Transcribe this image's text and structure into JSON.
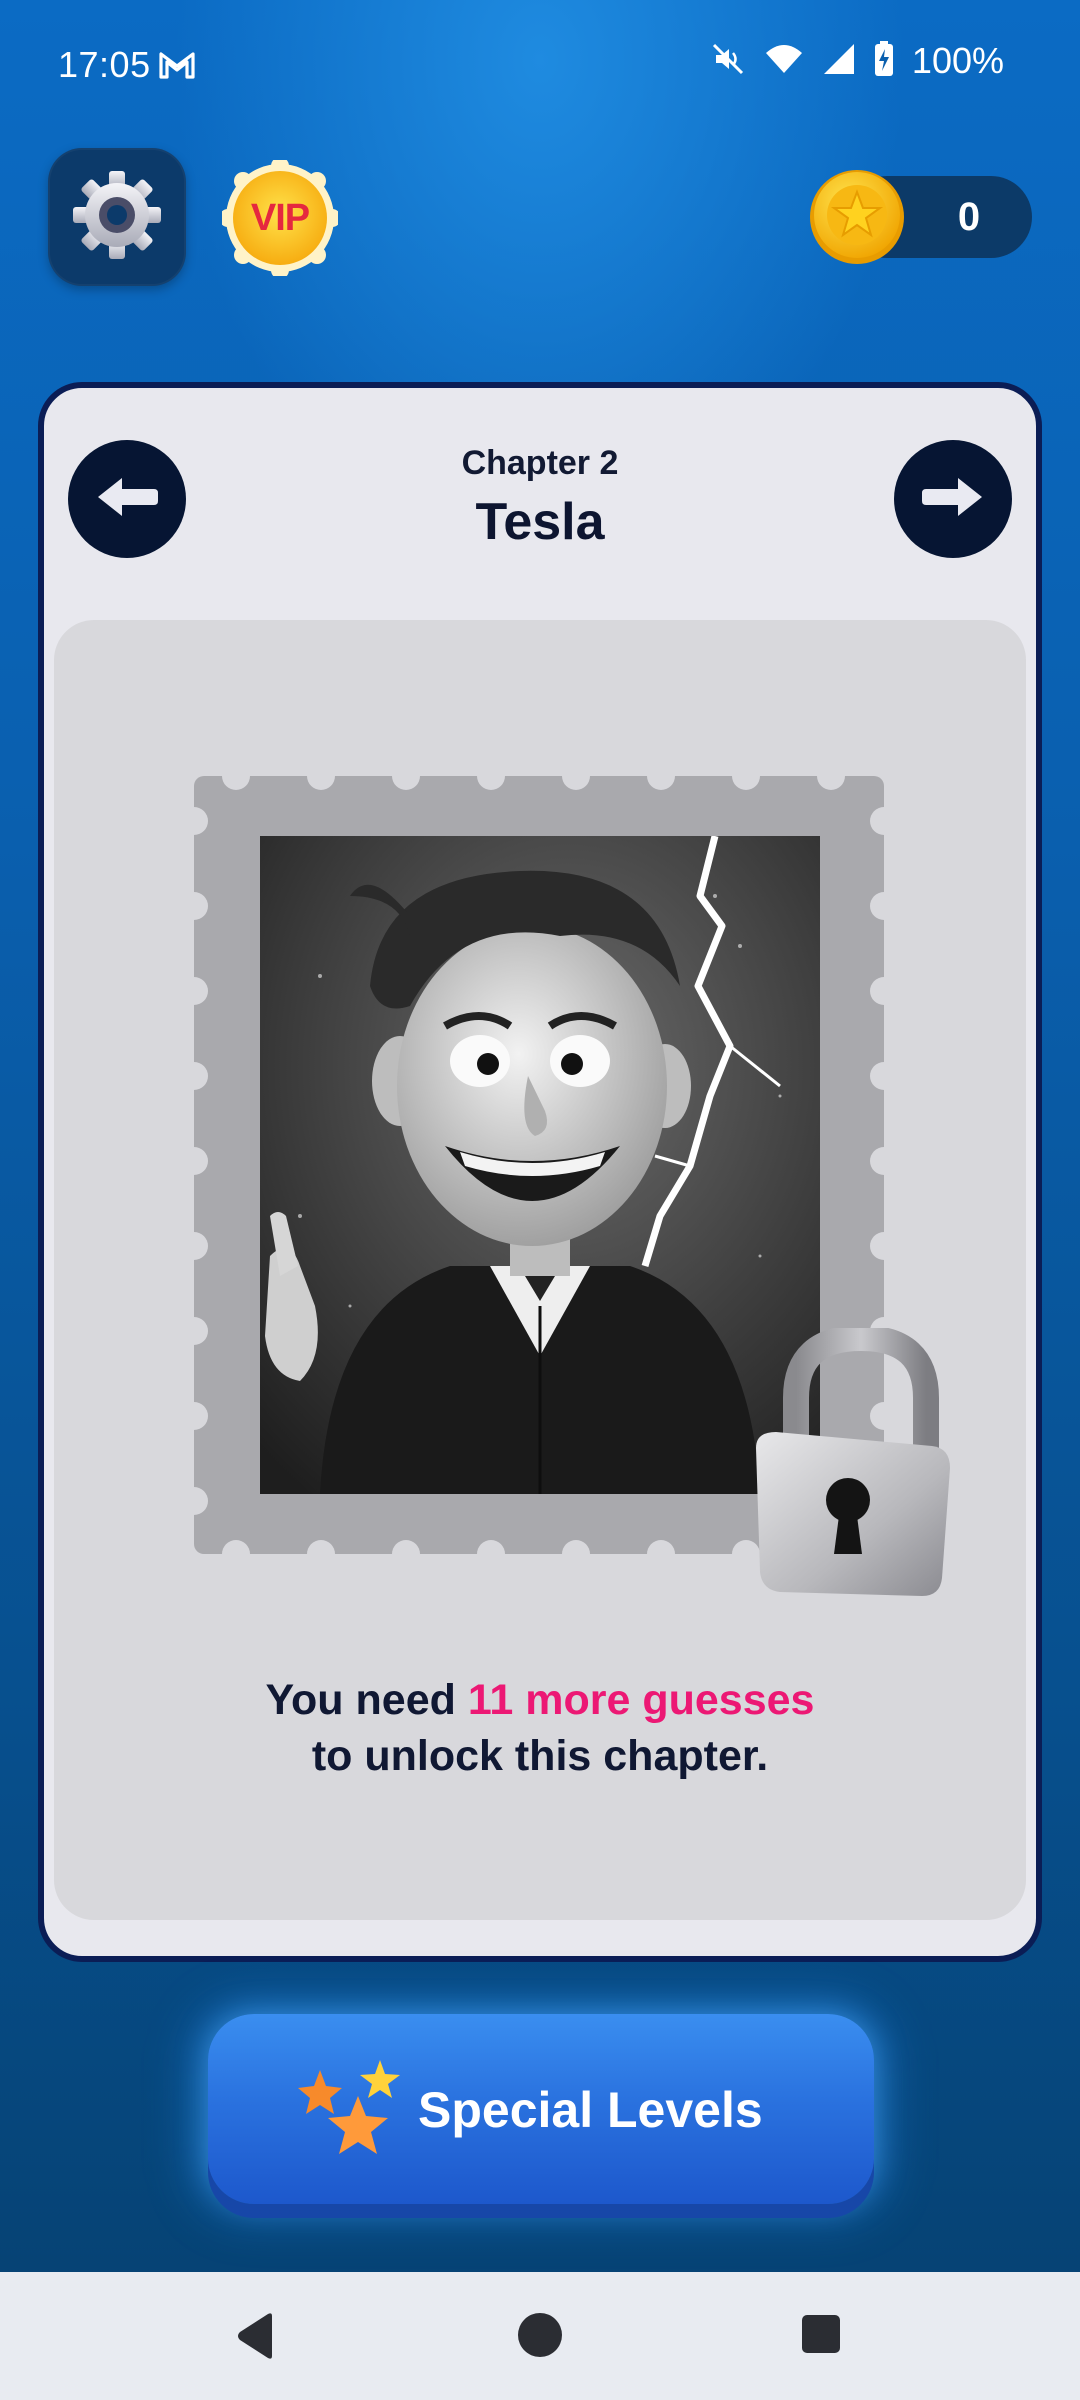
{
  "status_bar": {
    "time": "17:05",
    "battery": "100%",
    "icons": [
      "gmail-icon",
      "mute-icon",
      "wifi-icon",
      "signal-icon",
      "battery-charging-icon"
    ]
  },
  "top_bar": {
    "settings_icon": "gear-icon",
    "vip_label": "VIP",
    "coin_count": "0",
    "coin_icon": "star-coin-icon"
  },
  "chapter": {
    "number_label": "Chapter 2",
    "title": "Tesla",
    "prev_icon": "arrow-left-icon",
    "next_icon": "arrow-right-icon",
    "image_subject": "Tesla caricature stamp",
    "locked": true,
    "message": {
      "prefix": "You need ",
      "highlight": "11 more guesses",
      "suffix": "to unlock this chapter."
    }
  },
  "special_button": {
    "label": "Special Levels",
    "icon": "stars-icon"
  },
  "system_nav": {
    "icons": [
      "back-icon",
      "home-icon",
      "recents-icon"
    ]
  },
  "colors": {
    "background_top": "#0b6bc4",
    "background_bottom": "#06406f",
    "card": "#e8e8ee",
    "panel": "#d8d8dc",
    "highlight": "#ec1874",
    "dark_navy": "#061533",
    "button_blue": "#2a72df"
  }
}
